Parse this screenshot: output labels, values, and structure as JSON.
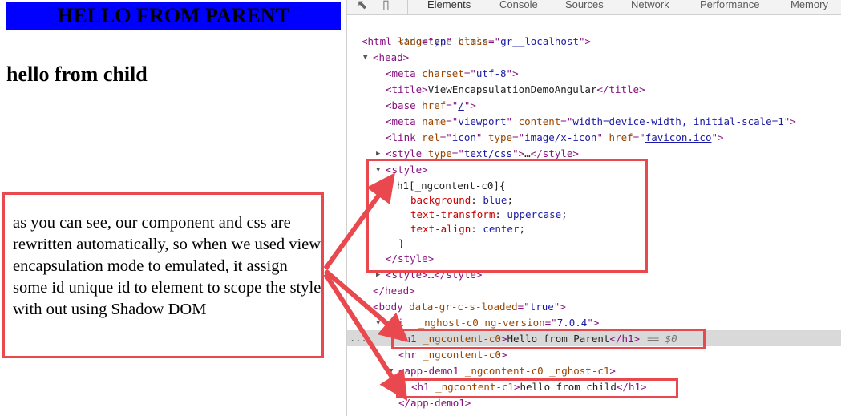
{
  "page": {
    "parent_heading": "HELLO FROM PARENT",
    "child_heading": "hello from child",
    "note": "as you can see, our component and css are rewritten automatically, so when we used view encapsulation mode to emulated, it assign some id unique id to element to scope the style with out using Shadow DOM"
  },
  "devtools": {
    "tabs": [
      "Elements",
      "Console",
      "Sources",
      "Network",
      "Performance",
      "Memory"
    ],
    "active_tab": "Elements",
    "selected_suffix": "== $0",
    "dots": "...",
    "lines": {
      "doctype": "<!doctype html>",
      "html_open": [
        "<html ",
        "lang",
        "=\"",
        "en",
        "\" ",
        "class",
        "=\"",
        "gr__localhost",
        "\">"
      ],
      "head_open": "<head>",
      "meta_charset": [
        "<meta ",
        "charset",
        "=\"",
        "utf-8",
        "\">"
      ],
      "title": [
        "<title>",
        "ViewEncapsulationDemoAngular",
        "</title>"
      ],
      "base": [
        "<base ",
        "href",
        "=\"",
        "/",
        "\">"
      ],
      "meta_viewport": [
        "<meta ",
        "name",
        "=\"",
        "viewport",
        "\" ",
        "content",
        "=\"",
        "width=device-width, initial-scale=1",
        "\">"
      ],
      "link": [
        "<link ",
        "rel",
        "=\"",
        "icon",
        "\" ",
        "type",
        "=\"",
        "image/x-icon",
        "\" ",
        "href",
        "=\"",
        "favicon.ico",
        "\">"
      ],
      "style_css": [
        "<style ",
        "type",
        "=\"",
        "text/css",
        "\">",
        "…",
        "</style>"
      ],
      "style_open": "<style>",
      "css_selector": "h1[_ngcontent-c0]{",
      "css_rules": [
        {
          "prop": "background",
          "value": "blue"
        },
        {
          "prop": "text-transform",
          "value": "uppercase"
        },
        {
          "prop": "text-align",
          "value": "center"
        }
      ],
      "css_close": "}",
      "style_close": "</style>",
      "style_collapsed": [
        "<style>",
        "…",
        "</style>"
      ],
      "head_close": "</head>",
      "body_open": [
        "<body ",
        "data-gr-c-s-loaded",
        "=\"",
        "true",
        "\">"
      ],
      "app_root": [
        "<ji",
        "_nghost-c0 ",
        "ng-version",
        "=\"",
        "7.0.4",
        "\">"
      ],
      "h1_parent": [
        "<h1 ",
        "_ngcontent-c0",
        ">",
        "Hello from Parent",
        "</h1>"
      ],
      "hr": [
        "<hr ",
        "_ngcontent-c0",
        ">"
      ],
      "app_demo": [
        "<app-demo1 ",
        "_ngcontent-c0 ",
        "_nghost-c1",
        ">"
      ],
      "h1_child": [
        "<h1 ",
        "_ngcontent-c1",
        ">",
        "hello from child",
        "</h1>"
      ],
      "app_demo_close": "</app-demo1>"
    }
  },
  "colors": {
    "accent_red": "#e8484e",
    "blue_heading": "#0000ff",
    "tag": "#881280",
    "attr_name": "#994500",
    "attr_value": "#1a1aa6"
  }
}
